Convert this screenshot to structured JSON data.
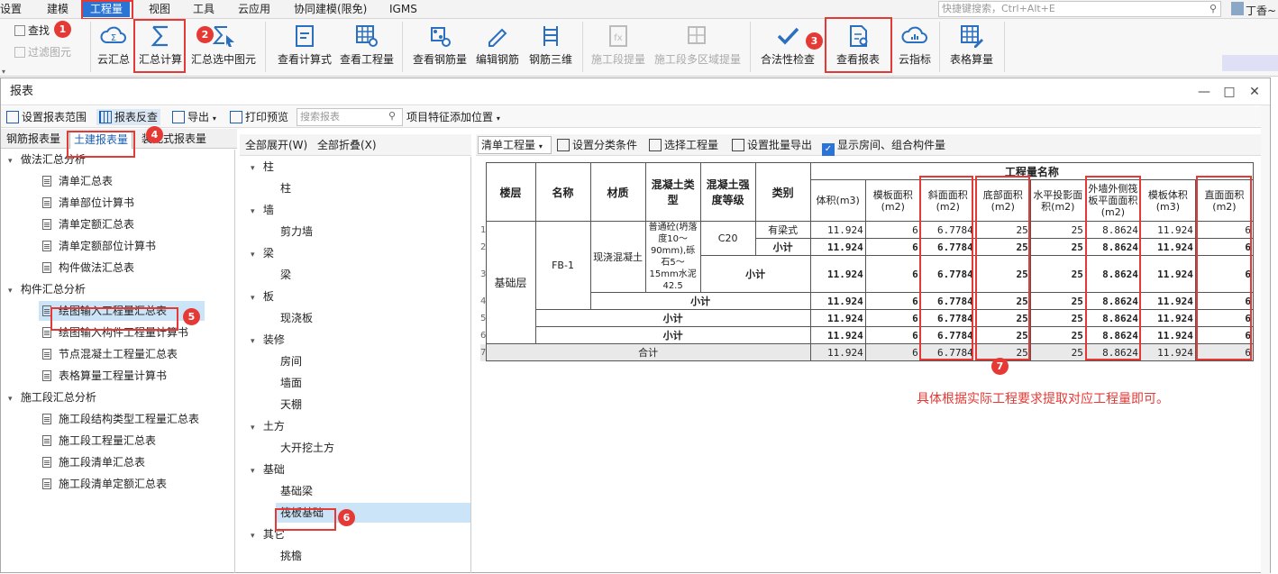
{
  "menu": {
    "items": [
      "设置",
      "建模",
      "工程量",
      "视图",
      "工具",
      "云应用",
      "协同建模(限免)",
      "IGMS"
    ],
    "search_placeholder": "快捷键搜索，Ctrl+Alt+E",
    "user": "丁香~"
  },
  "ribbon": {
    "left_small": [
      "查找",
      "过滤图元"
    ],
    "buttons": [
      "云汇总",
      "汇总计算",
      "汇总选中图元",
      "查看计算式",
      "查看工程量",
      "查看钢筋量",
      "编辑钢筋",
      "钢筋三维",
      "施工段提量",
      "施工段多区域提量",
      "合法性检查",
      "查看报表",
      "云指标",
      "表格算量"
    ]
  },
  "dialog": {
    "title": "报表",
    "toolbar": [
      "设置报表范围",
      "报表反查",
      "导出",
      "打印预览"
    ],
    "search_placeholder": "搜索报表",
    "feature_label": "项目特征添加位置"
  },
  "left": {
    "tabs": [
      "钢筋报表量",
      "土建报表量",
      "装配式报表量"
    ],
    "groups": [
      {
        "label": "做法汇总分析",
        "items": [
          "清单汇总表",
          "清单部位计算书",
          "清单定额汇总表",
          "清单定额部位计算书",
          "构件做法汇总表"
        ]
      },
      {
        "label": "构件汇总分析",
        "items": [
          "绘图输入工程量汇总表",
          "绘图输入构件工程量计算书",
          "节点混凝土工程量汇总表",
          "表格算量工程量计算书"
        ]
      },
      {
        "label": "施工段汇总分析",
        "items": [
          "施工段结构类型工程量汇总表",
          "施工段工程量汇总表",
          "施工段清单汇总表",
          "施工段清单定额汇总表"
        ]
      }
    ]
  },
  "mid": {
    "expand": "全部展开(W)",
    "collapse": "全部折叠(X)",
    "tree": [
      {
        "label": "柱",
        "items": [
          "柱"
        ]
      },
      {
        "label": "墙",
        "items": [
          "剪力墙"
        ]
      },
      {
        "label": "梁",
        "items": [
          "梁"
        ]
      },
      {
        "label": "板",
        "items": [
          "现浇板"
        ]
      },
      {
        "label": "装修",
        "items": [
          "房间",
          "墙面",
          "天棚"
        ]
      },
      {
        "label": "土方",
        "items": [
          "大开挖土方"
        ]
      },
      {
        "label": "基础",
        "items": [
          "基础梁",
          "筏板基础"
        ]
      },
      {
        "label": "其它",
        "items": [
          "挑檐"
        ]
      }
    ]
  },
  "right_toolbar": {
    "mode": "清单工程量",
    "buttons": [
      "设置分类条件",
      "选择工程量",
      "设置批量导出"
    ],
    "checkbox": "显示房间、组合构件量"
  },
  "table": {
    "group_header": "工程量名称",
    "headers": [
      "楼层",
      "名称",
      "材质",
      "混凝土类型",
      "混凝土强度等级",
      "类别"
    ],
    "qty_headers": [
      "体积(m3)",
      "模板面积(m2)",
      "斜面面积(m2)",
      "底部面积(m2)",
      "水平投影面积(m2)",
      "外墙外侧筏板平面面积(m2)",
      "模板体积(m3)",
      "直面面积(m2)"
    ],
    "floor": "基础层",
    "name": "FB-1",
    "material": "现浇混凝土",
    "concrete_type": "普通砼(坍落度10～90mm),砾石5～15mm水泥42.5",
    "grade": "C20",
    "category": "有梁式",
    "subtotal": "小计",
    "total": "合计",
    "row_numbers": [
      "1",
      "2",
      "3",
      "4",
      "5",
      "6",
      "7"
    ],
    "values": [
      "11.924",
      "6",
      "6.7784",
      "25",
      "25",
      "8.8624",
      "11.924",
      "6"
    ]
  },
  "callouts": [
    "1",
    "2",
    "3",
    "4",
    "5",
    "6",
    "7"
  ],
  "note": "具体根据实际工程要求提取对应工程量即可。",
  "colors": {
    "accent": "#2b74d6",
    "highlight": "#e53935"
  }
}
